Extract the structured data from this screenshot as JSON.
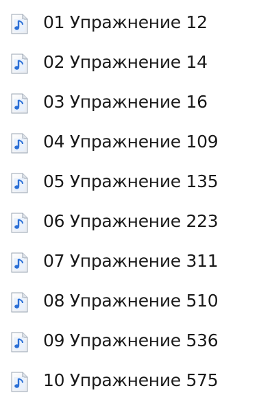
{
  "files": [
    {
      "name": "01  Упражнение 12",
      "icon": "audio-file-icon"
    },
    {
      "name": "02  Упражнение 14",
      "icon": "audio-file-icon"
    },
    {
      "name": "03  Упражнение 16",
      "icon": "audio-file-icon"
    },
    {
      "name": "04  Упражнение 109",
      "icon": "audio-file-icon"
    },
    {
      "name": "05  Упражнение 135",
      "icon": "audio-file-icon"
    },
    {
      "name": "06  Упражнение 223",
      "icon": "audio-file-icon"
    },
    {
      "name": "07  Упражнение 311",
      "icon": "audio-file-icon"
    },
    {
      "name": "08  Упражнение 510",
      "icon": "audio-file-icon"
    },
    {
      "name": "09  Упражнение 536",
      "icon": "audio-file-icon"
    },
    {
      "name": "10  Упражнение 575",
      "icon": "audio-file-icon"
    }
  ],
  "colors": {
    "text": "#1a1a1a",
    "icon_note": "#2a6fd6",
    "icon_page_border": "#9aa4b2"
  }
}
